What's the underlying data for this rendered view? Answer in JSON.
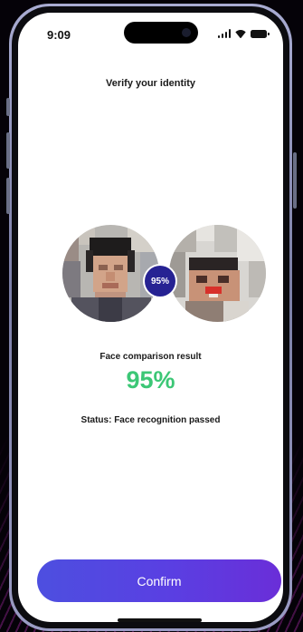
{
  "status_bar": {
    "time": "9:09"
  },
  "header": {
    "title": "Verify your identity"
  },
  "comparison": {
    "badge": "95%",
    "result_label": "Face comparison result",
    "score": "95%",
    "status": "Status: Face recognition passed"
  },
  "actions": {
    "confirm_label": "Confirm"
  },
  "colors": {
    "accent": "#4d4fe0",
    "badge": "#262293",
    "score": "#3cc776"
  }
}
